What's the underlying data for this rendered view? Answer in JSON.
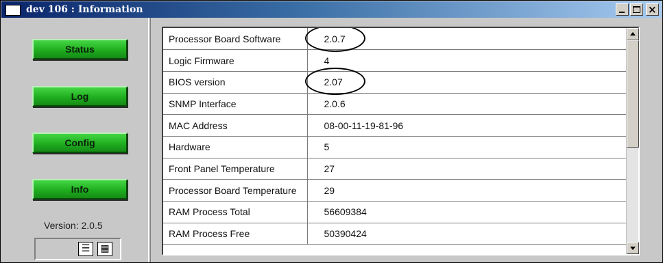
{
  "window": {
    "title": "dev 106 : Information",
    "controls": {
      "minimize": "_",
      "maximize": "□",
      "close": "×"
    }
  },
  "nav": {
    "status_label": "Status",
    "log_label": "Log",
    "config_label": "Config",
    "info_label": "Info"
  },
  "footer": {
    "version_label": "Version: 2.0.5",
    "list_view_icon": "list-view-icon",
    "grid_view_icon": "grid-view-icon"
  },
  "table": {
    "rows": [
      {
        "label": "Processor Board Software",
        "value": "2.0.7",
        "circled": true
      },
      {
        "label": "Logic Firmware",
        "value": "4",
        "circled": false
      },
      {
        "label": "BIOS version",
        "value": "2.07",
        "circled": true
      },
      {
        "label": "SNMP Interface",
        "value": "2.0.6",
        "circled": false
      },
      {
        "label": "MAC Address",
        "value": "08-00-11-19-81-96",
        "circled": false
      },
      {
        "label": "Hardware",
        "value": "5",
        "circled": false
      },
      {
        "label": "Front Panel Temperature",
        "value": "27",
        "circled": false
      },
      {
        "label": "Processor Board Temperature",
        "value": "29",
        "circled": false
      },
      {
        "label": "RAM Process Total",
        "value": "56609384",
        "circled": false
      },
      {
        "label": "RAM Process Free",
        "value": "50390424",
        "circled": false
      }
    ]
  },
  "colors": {
    "titlebar_start": "#0a246a",
    "titlebar_end": "#a6caf0",
    "button_green": "#1fae1f",
    "panel_gray": "#c8c8c8"
  }
}
